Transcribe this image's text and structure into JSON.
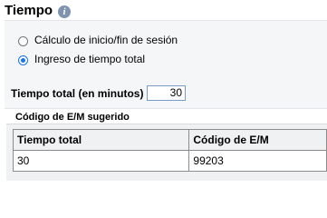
{
  "section": {
    "title": "Tiempo",
    "info_icon": "info-icon"
  },
  "options": [
    {
      "label": "Cálculo de inicio/fin de sesión",
      "checked": false
    },
    {
      "label": "Ingreso de tiempo total",
      "checked": true
    }
  ],
  "total": {
    "label": "Tiempo total (en minutos)",
    "value": "30"
  },
  "suggested": {
    "title": "Código de E/M sugerido",
    "headers": [
      "Tiempo total",
      "Código de E/M"
    ],
    "rows": [
      [
        "30",
        "99203"
      ]
    ]
  },
  "colors": {
    "accent": "#1a73e8",
    "input_border": "#7a9cc8",
    "panel_bg": "#f5f6f8"
  }
}
